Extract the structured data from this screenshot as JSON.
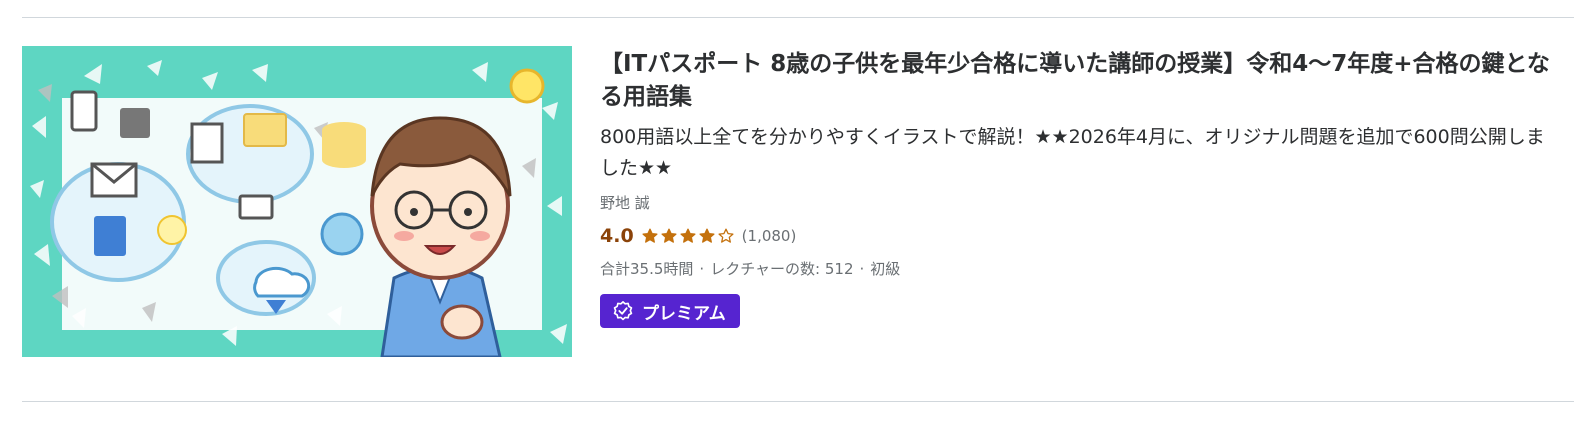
{
  "course": {
    "title": "【ITパスポート 8歳の子供を最年少合格に導いた講師の授業】令和4〜7年度+合格の鍵となる用語集",
    "headline": "800用語以上全てを分かりやすくイラストで解説！★★2026年4月に、オリジナル問題を追加で600問公開しました★★",
    "instructor": "野地 誠",
    "rating": {
      "value": "4.0",
      "count": "(1,080)",
      "stars_filled": 4,
      "stars_total": 5
    },
    "meta": {
      "total_hours": "合計35.5時間",
      "lectures": "レクチャーの数: 512",
      "level": "初級",
      "separator": "·"
    },
    "badge": {
      "label": "プレミアム",
      "icon": "verified-badge-icon"
    },
    "thumbnail": {
      "icon": "course-thumbnail-illustration"
    }
  },
  "colors": {
    "rating": "#8b4309",
    "star": "#c4710d",
    "badge_bg": "#5624d0",
    "thumb_bg": "#5ed6c2",
    "text": "#2d2f31",
    "muted": "#6a6f73"
  }
}
